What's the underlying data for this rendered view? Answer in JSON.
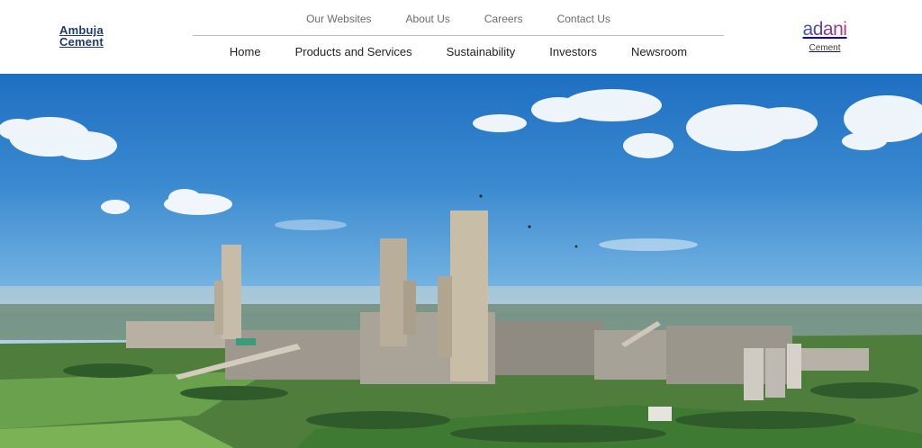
{
  "brand": {
    "left_line1": "Ambuja",
    "left_line2": "Cement",
    "right_logo": "adani",
    "right_sub": "Cement"
  },
  "nav_top": [
    {
      "label": "Our Websites"
    },
    {
      "label": "About Us"
    },
    {
      "label": "Careers"
    },
    {
      "label": "Contact Us"
    }
  ],
  "nav_main": [
    {
      "label": "Home"
    },
    {
      "label": "Products and Services"
    },
    {
      "label": "Sustainability"
    },
    {
      "label": "Investors"
    },
    {
      "label": "Newsroom"
    }
  ],
  "colors": {
    "brand_blue": "#1f3a6b",
    "sky_top": "#1d6fc2",
    "sky_bottom": "#a6cfe8",
    "field_green": "#4f8a3a"
  },
  "hero": {
    "image": "cement-plant-aerial-photo"
  }
}
